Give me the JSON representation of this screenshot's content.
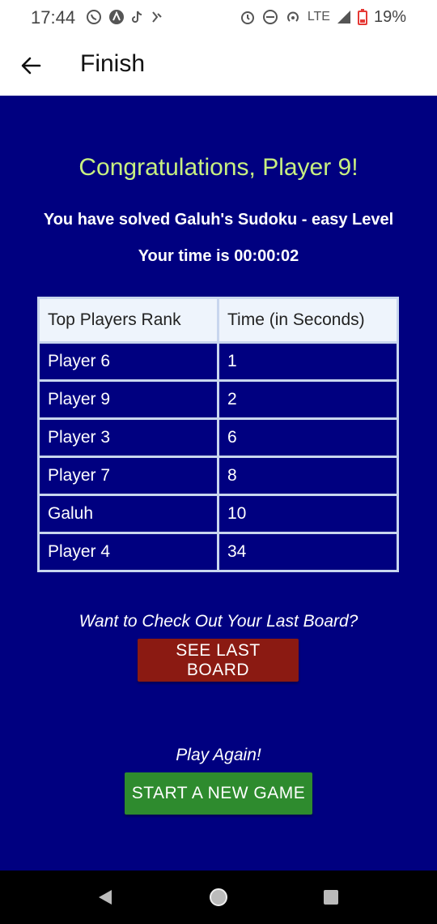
{
  "status_bar": {
    "time": "17:44",
    "network": "LTE",
    "battery": "19%",
    "icons_left": [
      "whatsapp-icon",
      "app-icon",
      "tiktok-icon",
      "app-icon"
    ],
    "icons_right": [
      "alarm-icon",
      "dnd-icon",
      "hotspot-icon",
      "signal-icon",
      "battery-icon"
    ]
  },
  "app_bar": {
    "title": "Finish",
    "back_icon": "arrow-left-icon"
  },
  "main": {
    "congrats": "Congratulations, Player 9!",
    "solved_text": "You have solved Galuh's Sudoku - easy Level",
    "time_text": "Your time is 00:00:02",
    "table": {
      "headers": [
        "Top Players Rank",
        "Time (in Seconds)"
      ],
      "rows": [
        [
          "Player 6",
          "1"
        ],
        [
          "Player 9",
          "2"
        ],
        [
          "Player 3",
          "6"
        ],
        [
          "Player 7",
          "8"
        ],
        [
          "Galuh",
          "10"
        ],
        [
          "Player 4",
          "34"
        ]
      ]
    },
    "checkout_prompt": "Want to Check Out Your Last Board?",
    "see_last_board_label": "SEE LAST BOARD",
    "play_again_prompt": "Play Again!",
    "start_new_game_label": "START A NEW GAME"
  },
  "colors": {
    "background": "#000080",
    "congrats": "#c8f080",
    "see_button": "#8b1a12",
    "new_game_button": "#2e8b2e"
  },
  "nav_bar": {
    "icons": [
      "back-triangle-icon",
      "home-circle-icon",
      "recents-square-icon"
    ]
  }
}
